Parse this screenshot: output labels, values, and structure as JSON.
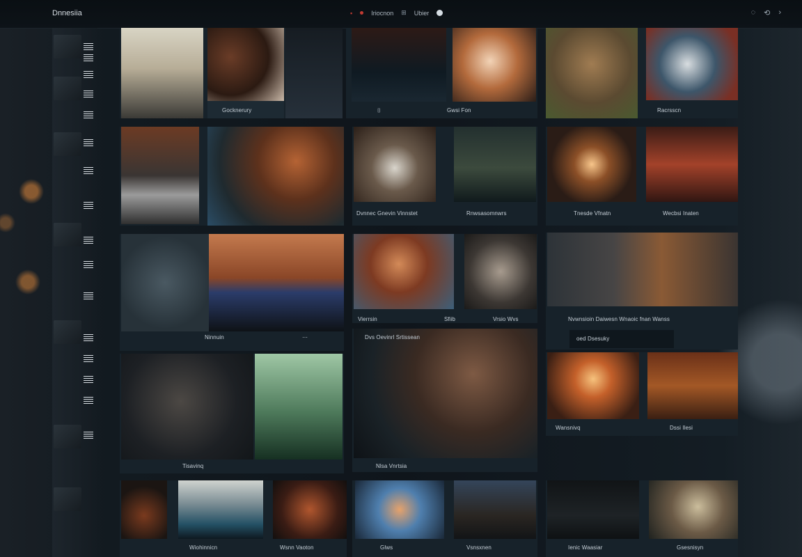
{
  "app": {
    "brand": "Dnnesiia"
  },
  "nav": {
    "item1": "Iriocnon",
    "item2": "Ubier"
  },
  "captions": {
    "c1": "Gocknerury",
    "c2": "Gwsi Fon",
    "c3": "Racrsscn",
    "c4": "Dvnnec  Gnevin  Vinnstet",
    "c5": "Rnwsasomnwrs",
    "c6": "Tnesde  Vfnatn",
    "c7": "Wecbsi Inaten",
    "c8": "Ninnuin",
    "c9": "Vierrsin",
    "c10": "Sfiib",
    "c11": "Vrsio  Wvs",
    "c12": "Nvwnsioin Daiwesn Wnaoic fnan Wanss",
    "c13": "oed  Dsesuky",
    "c14": "Dvs  Oevinrl Srtissean",
    "c15": "Tisavinq",
    "c16": "Wansnivq",
    "c17": "Dssi Ilesi",
    "c18": "Nlsa  Vnrtsia",
    "c19": "Wiohinnicn",
    "c20": "Wsnn  Vaoton",
    "c21": "Glws",
    "c22": "Vsnsxnen",
    "c23": "Ienic  Waasiar",
    "c24": "Gsesnisyn"
  },
  "colors": {
    "background": "#0e1419",
    "panel": "#17222a",
    "accent_red": "#c23b32",
    "caption_text": "#c7d0d8"
  },
  "icons": {
    "nav1": "red-square-icon",
    "nav2": "red-dot-icon",
    "nav3": "grid-icon",
    "nav4": "info-icon",
    "right1": "chat-icon",
    "right2": "share-icon",
    "right3": "chevron-right-icon"
  }
}
